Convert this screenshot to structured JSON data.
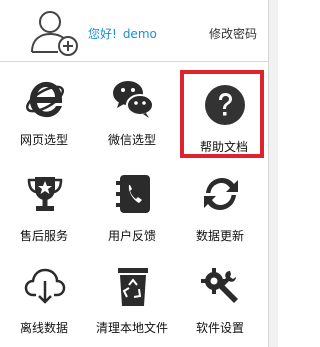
{
  "header": {
    "greeting": "您好!",
    "username": "demo",
    "change_password": "修改密码"
  },
  "tiles": [
    {
      "label": "网页选型",
      "icon": "ie-browser-icon"
    },
    {
      "label": "微信选型",
      "icon": "wechat-icon"
    },
    {
      "label": "帮助文档",
      "icon": "help-question-icon",
      "selected": true
    },
    {
      "label": "售后服务",
      "icon": "trophy-star-icon"
    },
    {
      "label": "用户反馈",
      "icon": "phone-book-icon"
    },
    {
      "label": "数据更新",
      "icon": "refresh-arrows-icon"
    },
    {
      "label": "离线数据",
      "icon": "cloud-download-icon"
    },
    {
      "label": "清理本地文件",
      "icon": "trash-recycle-icon"
    },
    {
      "label": "软件设置",
      "icon": "settings-gear-wrench-icon"
    }
  ],
  "colors": {
    "accent_blue": "#1a8fd6",
    "selection_red": "#e0212e",
    "icon_dark": "#2b2b2b"
  }
}
